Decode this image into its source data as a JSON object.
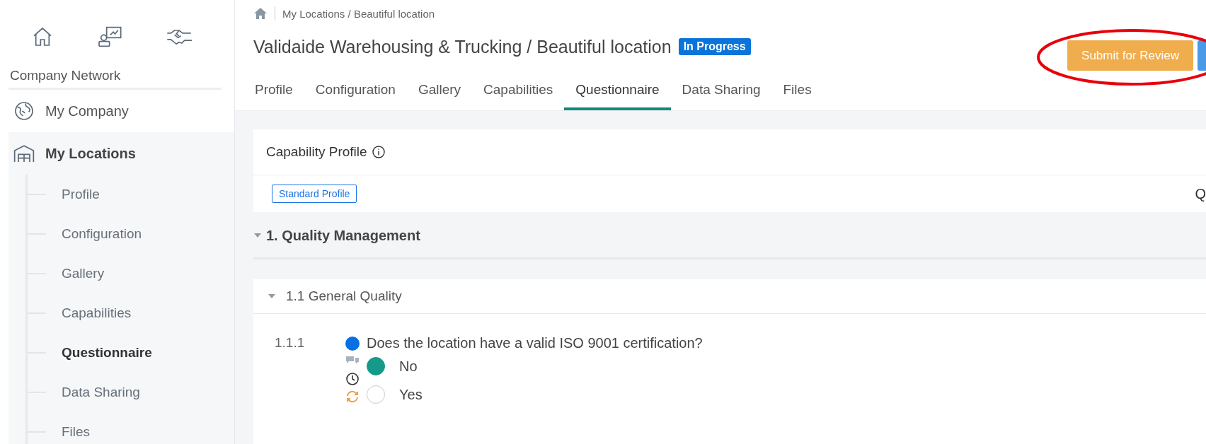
{
  "sidebar": {
    "section_title": "Company Network",
    "items": [
      {
        "label": "My Company",
        "selected": false
      },
      {
        "label": "My Locations",
        "selected": true,
        "children": [
          {
            "label": "Profile",
            "selected": false
          },
          {
            "label": "Configuration",
            "selected": false
          },
          {
            "label": "Gallery",
            "selected": false
          },
          {
            "label": "Capabilities",
            "selected": false
          },
          {
            "label": "Questionnaire",
            "selected": true
          },
          {
            "label": "Data Sharing",
            "selected": false
          },
          {
            "label": "Files",
            "selected": false
          }
        ]
      }
    ]
  },
  "breadcrumb": "My Locations / Beautiful location",
  "header": {
    "title": "Validaide Warehousing & Trucking / Beautiful location",
    "status": "In Progress"
  },
  "actions": [
    {
      "label": "Submit for Review",
      "kind": "warning"
    }
  ],
  "tabs": [
    {
      "label": "Profile",
      "selected": false
    },
    {
      "label": "Configuration",
      "selected": false
    },
    {
      "label": "Gallery",
      "selected": false
    },
    {
      "label": "Capabilities",
      "selected": false
    },
    {
      "label": "Questionnaire",
      "selected": true
    },
    {
      "label": "Data Sharing",
      "selected": false
    },
    {
      "label": "Files",
      "selected": false
    }
  ],
  "capability_profile": {
    "title": "Capability Profile",
    "tag": "Standard Profile",
    "column_2": "Q"
  },
  "sections": [
    {
      "title": "1. Quality Management",
      "expanded": true,
      "subsections": [
        {
          "title": "1.1 General Quality",
          "expanded": true,
          "questions": [
            {
              "number": "1.1.1",
              "color": "#0a6fe0",
              "text": "Does the location have a valid ISO 9001 certification?",
              "options": [
                {
                  "label": "No",
                  "selected": true
                },
                {
                  "label": "Yes",
                  "selected": false
                }
              ]
            }
          ]
        }
      ]
    }
  ]
}
